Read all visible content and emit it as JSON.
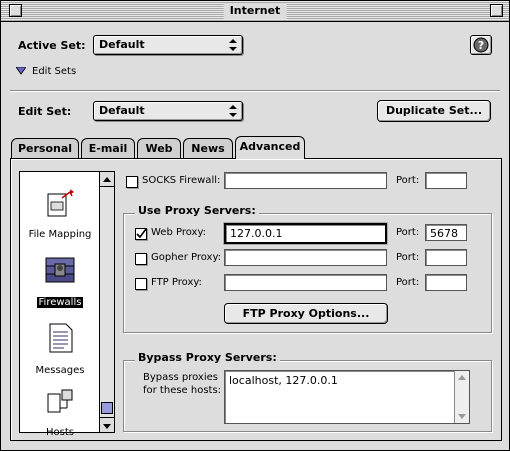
{
  "window": {
    "title": "Internet"
  },
  "header": {
    "active_set_label": "Active Set:",
    "active_set_value": "Default",
    "edit_sets_label": "Edit Sets",
    "edit_set_label": "Edit Set:",
    "edit_set_value": "Default",
    "duplicate_button": "Duplicate Set..."
  },
  "tabs": [
    {
      "label": "Personal"
    },
    {
      "label": "E-mail"
    },
    {
      "label": "Web"
    },
    {
      "label": "News"
    },
    {
      "label": "Advanced"
    }
  ],
  "sidebar": {
    "items": [
      {
        "label": "File Mapping"
      },
      {
        "label": "Firewalls"
      },
      {
        "label": "Messages"
      },
      {
        "label": "Hosts"
      }
    ]
  },
  "firewall": {
    "socks_label": "SOCKS Firewall:",
    "port_label": "Port:",
    "socks_value": "",
    "socks_port": ""
  },
  "proxy": {
    "group_title": "Use Proxy Servers:",
    "web_label": "Web Proxy:",
    "web_value": "127.0.0.1",
    "web_port": "5678",
    "web_checked": true,
    "gopher_label": "Gopher Proxy:",
    "gopher_value": "",
    "gopher_port": "",
    "ftp_label": "FTP Proxy:",
    "ftp_value": "",
    "ftp_port": "",
    "port_label": "Port:",
    "ftp_options_button": "FTP Proxy Options..."
  },
  "bypass": {
    "group_title": "Bypass Proxy Servers:",
    "label_line1": "Bypass proxies",
    "label_line2": "for these hosts:",
    "value": "localhost, 127.0.0.1"
  }
}
